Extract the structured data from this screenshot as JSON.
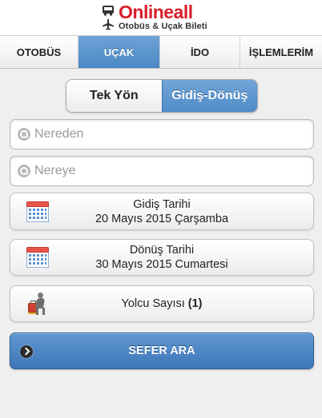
{
  "brand": {
    "name": "Onlineall",
    "subtitle": "Otobüs & Uçak Bileti"
  },
  "tabs": [
    {
      "label": "OTOBÜS",
      "active": false
    },
    {
      "label": "UÇAK",
      "active": true
    },
    {
      "label": "İDO",
      "active": false
    },
    {
      "label": "İŞLEMLERİM",
      "active": false
    }
  ],
  "trip_type": {
    "one_way": "Tek Yön",
    "round_trip": "Gidiş-Dönüş",
    "selected": "Gidiş-Dönüş"
  },
  "from": {
    "value": "",
    "placeholder": "Nereden"
  },
  "to": {
    "value": "",
    "placeholder": "Nereye"
  },
  "departure": {
    "label": "Gidiş Tarihi",
    "date": "20 Mayıs 2015 Çarşamba"
  },
  "return": {
    "label": "Dönüş Tarihi",
    "date": "30 Mayıs 2015 Cumartesi"
  },
  "passengers": {
    "label": "Yolcu Sayısı",
    "count": "(1)"
  },
  "search_button": "SEFER ARA",
  "colors": {
    "brand_red": "#d8202a",
    "accent_blue": "#4a88c6"
  },
  "icons": {
    "bus": "bus-icon",
    "plane": "plane-icon",
    "search": "search-icon",
    "calendar": "calendar-icon",
    "passenger": "passenger-icon",
    "go": "chevron-right-icon"
  }
}
